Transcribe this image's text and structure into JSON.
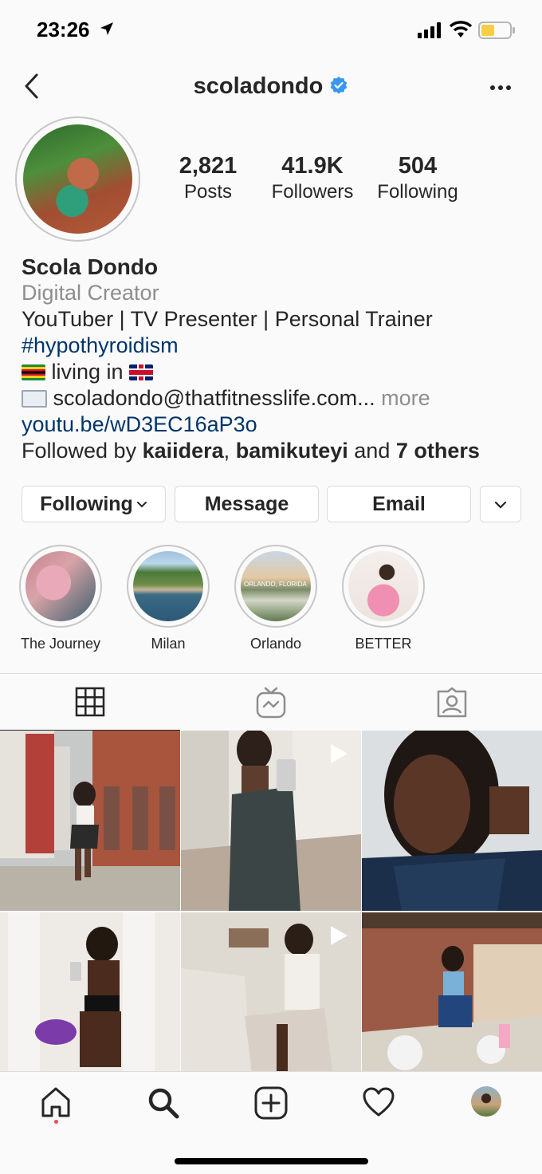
{
  "status_bar": {
    "time": "23:26"
  },
  "header": {
    "username": "scoladondo"
  },
  "stats": [
    {
      "value": "2,821",
      "label": "Posts"
    },
    {
      "value": "41.9K",
      "label": "Followers"
    },
    {
      "value": "504",
      "label": "Following"
    }
  ],
  "bio": {
    "name": "Scola Dondo",
    "category": "Digital Creator",
    "line1": "YouTuber | TV Presenter | Personal Trainer",
    "hashtag": "#hypothyroidism",
    "living": "living in",
    "email": "scoladondo@thatfitnesslife.com...",
    "more": "more",
    "link": "youtu.be/wD3EC16aP3o",
    "followed_by_prefix": "Followed by",
    "follower1": "kaiidera",
    "comma": ",",
    "follower2": "bamikuteyi",
    "and": "and",
    "others": "7 others"
  },
  "buttons": {
    "following": "Following",
    "message": "Message",
    "email": "Email"
  },
  "highlights": [
    {
      "label": "The Journey"
    },
    {
      "label": "Milan"
    },
    {
      "label": "Orlando",
      "image_text": "ORLANDO, FLORIDA"
    },
    {
      "label": "BETTER"
    }
  ],
  "colors": {
    "link": "#003569",
    "secondary_text": "#8e8e8e",
    "verified": "#3897f0",
    "notification_dot": "#ed4956"
  }
}
